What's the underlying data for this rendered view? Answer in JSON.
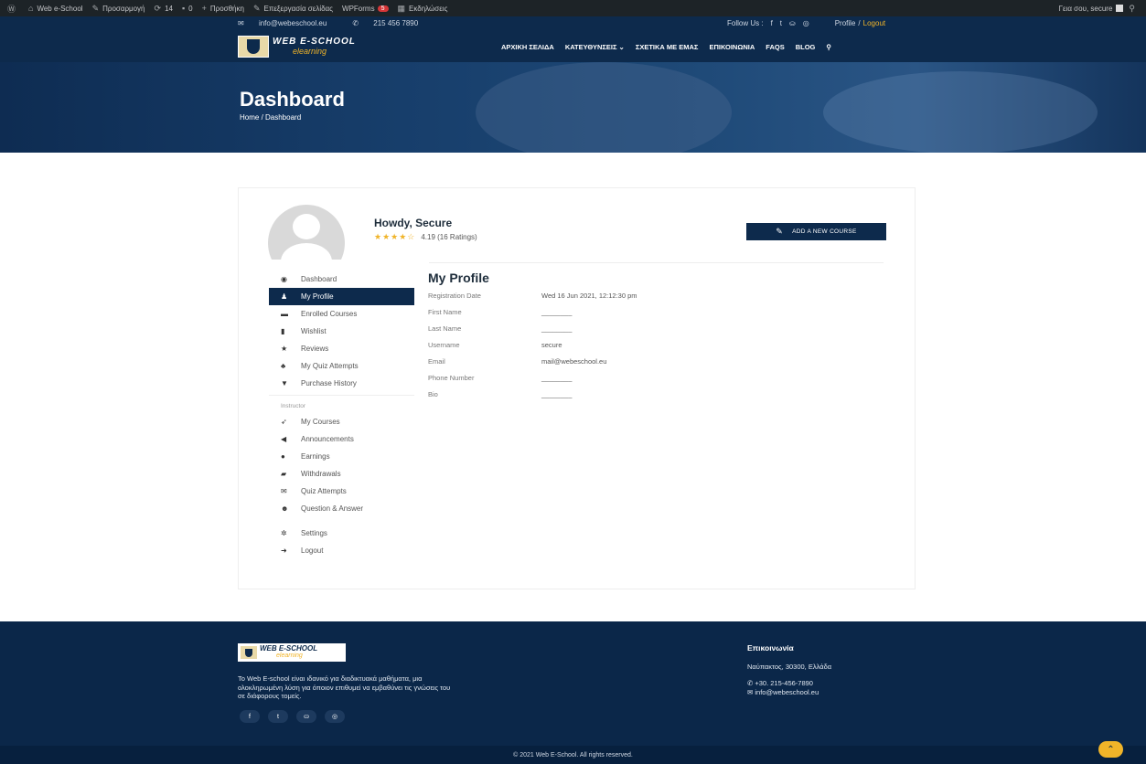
{
  "wp_admin_bar": {
    "items": [
      {
        "icon": "wordpress-icon",
        "glyph": "Ⓦ",
        "label": ""
      },
      {
        "icon": "site-icon",
        "glyph": "⌂",
        "label": "Web e-School"
      },
      {
        "icon": "customize-icon",
        "glyph": "✎",
        "label": "Προσαρμογή"
      },
      {
        "icon": "updates-icon",
        "glyph": "⟳",
        "label": "14"
      },
      {
        "icon": "comments-icon",
        "glyph": "▪",
        "label": "0"
      },
      {
        "icon": "plus-icon",
        "glyph": "+",
        "label": "Προσθήκη"
      },
      {
        "icon": "edit-icon",
        "glyph": "✎",
        "label": "Επεξεργασία σελίδας"
      },
      {
        "icon": "wpforms-icon",
        "glyph": "",
        "label": "WPForms",
        "badge": "5"
      },
      {
        "icon": "events-icon",
        "glyph": "▦",
        "label": "Εκδηλώσεις"
      }
    ],
    "greeting": "Γεια σου, secure"
  },
  "topinfo": {
    "email": "info@webeschool.eu",
    "phone": "215 456 7890",
    "follow": "Follow Us :",
    "social": [
      "f",
      "t",
      "⛀",
      "◎"
    ],
    "profile": "Profile",
    "divider": "/",
    "logout": "Logout"
  },
  "brand": {
    "line1": "WEB E-SCHOOL",
    "line2": "elearning"
  },
  "menu": [
    "ΑΡΧΙΚΗ ΣΕΛΙΔΑ",
    "ΚΑΤΕΥΘΥΝΣΕΙΣ ⌄",
    "ΣΧΕΤΙΚΑ ΜΕ ΕΜΑΣ",
    "ΕΠΙΚΟΙΝΩΝΙΑ",
    "FAQS",
    "BLOG",
    "⚲"
  ],
  "hero": {
    "title": "Dashboard",
    "breadcrumb": "Home / Dashboard"
  },
  "user": {
    "howdy": "Howdy, Secure",
    "stars": "★★★★☆",
    "rating": "4.19 (16 Ratings)",
    "rating_value": 4.19
  },
  "add_course_label": "ADD A NEW COURSE",
  "sidebar": {
    "items": [
      {
        "icon": "dashboard-icon",
        "glyph": "◉",
        "label": "Dashboard"
      },
      {
        "icon": "user-icon",
        "glyph": "♟",
        "label": "My Profile",
        "active": true
      },
      {
        "icon": "courses-icon",
        "glyph": "▬",
        "label": "Enrolled Courses"
      },
      {
        "icon": "bookmark-icon",
        "glyph": "▮",
        "label": "Wishlist"
      },
      {
        "icon": "star-icon",
        "glyph": "★",
        "label": "Reviews"
      },
      {
        "icon": "quiz-icon",
        "glyph": "♣",
        "label": "My Quiz Attempts"
      },
      {
        "icon": "cart-icon",
        "glyph": "▼",
        "label": "Purchase History"
      }
    ],
    "section_label": "Instructor",
    "instructor": [
      {
        "icon": "rocket-icon",
        "glyph": "➶",
        "label": "My Courses"
      },
      {
        "icon": "megaphone-icon",
        "glyph": "◀",
        "label": "Announcements"
      },
      {
        "icon": "earnings-icon",
        "glyph": "●",
        "label": "Earnings"
      },
      {
        "icon": "wallet-icon",
        "glyph": "▰",
        "label": "Withdrawals"
      },
      {
        "icon": "quiz-attempts-icon",
        "glyph": "✉",
        "label": "Quiz Attempts"
      },
      {
        "icon": "qa-icon",
        "glyph": "☻",
        "label": "Question & Answer"
      }
    ],
    "footer_items": [
      {
        "icon": "gear-icon",
        "glyph": "✲",
        "label": "Settings"
      },
      {
        "icon": "logout-icon",
        "glyph": "➜",
        "label": "Logout"
      }
    ]
  },
  "profile": {
    "title": "My Profile",
    "rows": [
      {
        "label": "Registration Date",
        "value": "Wed 16 Jun 2021, 12:12:30 pm"
      },
      {
        "label": "First Name",
        "value": "________"
      },
      {
        "label": "Last Name",
        "value": "________"
      },
      {
        "label": "Username",
        "value": "secure"
      },
      {
        "label": "Email",
        "value": "mail@webeschool.eu"
      },
      {
        "label": "Phone Number",
        "value": "________"
      },
      {
        "label": "Bio",
        "value": "________"
      }
    ]
  },
  "footer": {
    "brand_line1": "WEB E-SCHOOL",
    "brand_line2": "elearning",
    "description": "Το Web E-school είναι ιδανικό για διαδικτυακά μαθήματα, μια ολοκληρωμένη λύση για όποιον επιθυμεί να εμβαθύνει τις γνώσεις του σε διάφορους τομείς.",
    "social": [
      "f",
      "t",
      "⛀",
      "◎"
    ],
    "contact_title": "Επικοινωνία",
    "address": "Ναύπακτος, 30300, Ελλάδα",
    "phone": "+30. 215-456-7890",
    "email": "info@webeschool.eu",
    "copyright": "© 2021 Web E-School. All rights reserved.",
    "top_icon": "⌃"
  },
  "colors": {
    "navy": "#0d2a4c",
    "accent": "#f0b429"
  }
}
